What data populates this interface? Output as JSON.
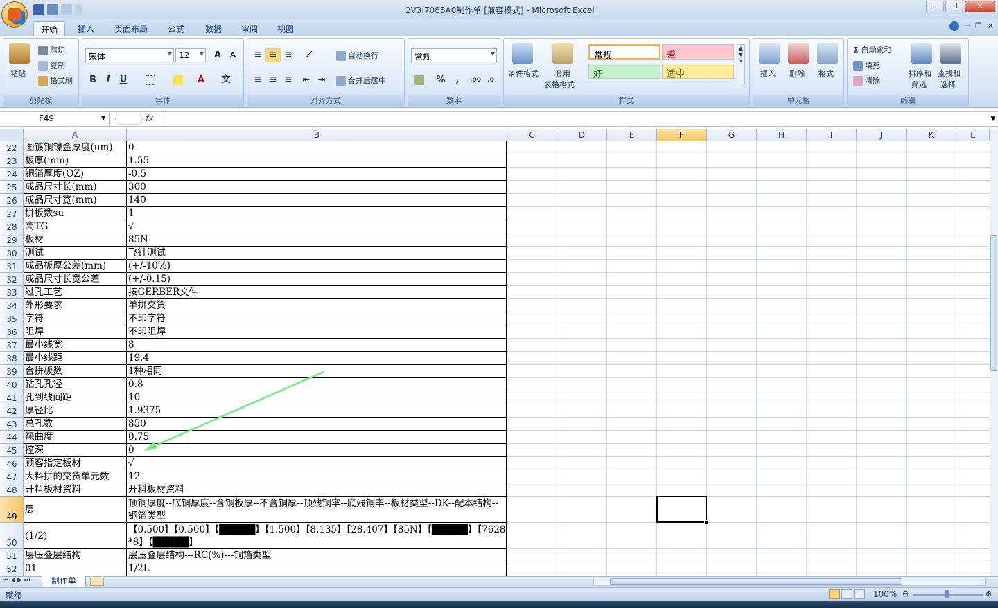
{
  "window": {
    "title": "2V3I7085A0制作单  [兼容模式] - Microsoft Excel",
    "minimize": "─",
    "restore": "❐",
    "close": "✕"
  },
  "ribbon_tabs": [
    "开始",
    "插入",
    "页面布局",
    "公式",
    "数据",
    "审阅",
    "视图"
  ],
  "ribbon": {
    "clipboard": {
      "paste": "粘贴",
      "cut": "剪切",
      "copy": "复制",
      "format_painter": "格式刷",
      "label": "剪贴板"
    },
    "font": {
      "name": "宋体",
      "size": "12",
      "label": "字体",
      "bold": "B",
      "italic": "I",
      "underline": "U",
      "grow": "A",
      "shrink": "A",
      "wen": "文"
    },
    "alignment": {
      "wrap": "自动换行",
      "merge": "合并后居中",
      "label": "对齐方式"
    },
    "number": {
      "format": "常规",
      "percent": "%",
      "comma": ",",
      "label": "数字"
    },
    "styles": {
      "conditional": "条件格式",
      "table_a": "套用",
      "table_b": "表格格式",
      "normal": "常规",
      "bad": "差",
      "good": "好",
      "neutral": "适中",
      "label": "样式"
    },
    "cells": {
      "insert": "插入",
      "delete": "删除",
      "format": "格式",
      "label": "单元格"
    },
    "editing": {
      "autosum": "自动求和",
      "fill": "填充",
      "clear": "清除",
      "sort_a": "排序和",
      "sort_b": "筛选",
      "find_a": "查找和",
      "find_b": "选择",
      "label": "编辑",
      "sigma": "Σ"
    }
  },
  "formula_bar": {
    "name_box": "F49",
    "fx": "fx",
    "value": ""
  },
  "columns": [
    "A",
    "B",
    "C",
    "D",
    "E",
    "F",
    "G",
    "H",
    "I",
    "J",
    "K",
    "L"
  ],
  "selected_column": "F",
  "rows": [
    {
      "n": "22",
      "a": "图镀铜镍金厚度(um)",
      "b": "0"
    },
    {
      "n": "23",
      "a": "板厚(mm)",
      "b": "1.55"
    },
    {
      "n": "24",
      "a": "铜箔厚度(OZ)",
      "b": "-0.5"
    },
    {
      "n": "25",
      "a": "成品尺寸长(mm)",
      "b": "300"
    },
    {
      "n": "26",
      "a": "成品尺寸宽(mm)",
      "b": "140"
    },
    {
      "n": "27",
      "a": "拼板数su",
      "b": "1"
    },
    {
      "n": "28",
      "a": "高TG",
      "b": "√"
    },
    {
      "n": "29",
      "a": "板材",
      "b": "85N"
    },
    {
      "n": "30",
      "a": "测试",
      "b": "飞针测试"
    },
    {
      "n": "31",
      "a": "成品板厚公差(mm)",
      "b": "(+/-10%)"
    },
    {
      "n": "32",
      "a": "成品尺寸长宽公差",
      "b": "(+/-0.15)"
    },
    {
      "n": "33",
      "a": "过孔工艺",
      "b": "按GERBER文件"
    },
    {
      "n": "34",
      "a": "外形要求",
      "b": "单拼交货"
    },
    {
      "n": "35",
      "a": "字符",
      "b": "不印字符"
    },
    {
      "n": "36",
      "a": "阻焊",
      "b": "不印阻焊"
    },
    {
      "n": "37",
      "a": "最小线宽",
      "b": "8"
    },
    {
      "n": "38",
      "a": "最小线距",
      "b": "19.4"
    },
    {
      "n": "39",
      "a": "合拼板数",
      "b": "1种相同"
    },
    {
      "n": "40",
      "a": "钻孔孔径",
      "b": "0.8"
    },
    {
      "n": "41",
      "a": "孔到线间距",
      "b": "10"
    },
    {
      "n": "42",
      "a": "厚径比",
      "b": "1.9375"
    },
    {
      "n": "43",
      "a": "总孔数",
      "b": "850"
    },
    {
      "n": "44",
      "a": "翘曲度",
      "b": "0.75"
    },
    {
      "n": "45",
      "a": "控深",
      "b": "0"
    },
    {
      "n": "46",
      "a": "顾客指定板材",
      "b": "√"
    },
    {
      "n": "47",
      "a": "大料拼的交货单元数",
      "b": "12"
    },
    {
      "n": "48",
      "a": "开料板材资料",
      "b": "开料板材资料"
    },
    {
      "n": "49",
      "a": "层",
      "b": "顶铜厚度--底铜厚度--含铜板厚--不含铜厚--顶残铜率--底残铜率--板材类型--DK--配本结构--铜箔类型"
    },
    {
      "n": "50",
      "a": "(1/2)",
      "b": "【0.500】【0.500】【█████】【1.500】【8.135】【28.407】【85N】【█████】【7628*8】【█████】"
    },
    {
      "n": "51",
      "a": "层压叠层结构",
      "b": "层压叠层结构---RC(%)---铜箔类型"
    },
    {
      "n": "52",
      "a": "01",
      "b": "1/2L"
    }
  ],
  "selected_row": "49",
  "sheet_tab": "制作单",
  "status": {
    "ready": "就绪",
    "zoom": "100%"
  },
  "colors": {
    "arrow": "#6ef07a",
    "selection_header": "#f6c65b"
  }
}
